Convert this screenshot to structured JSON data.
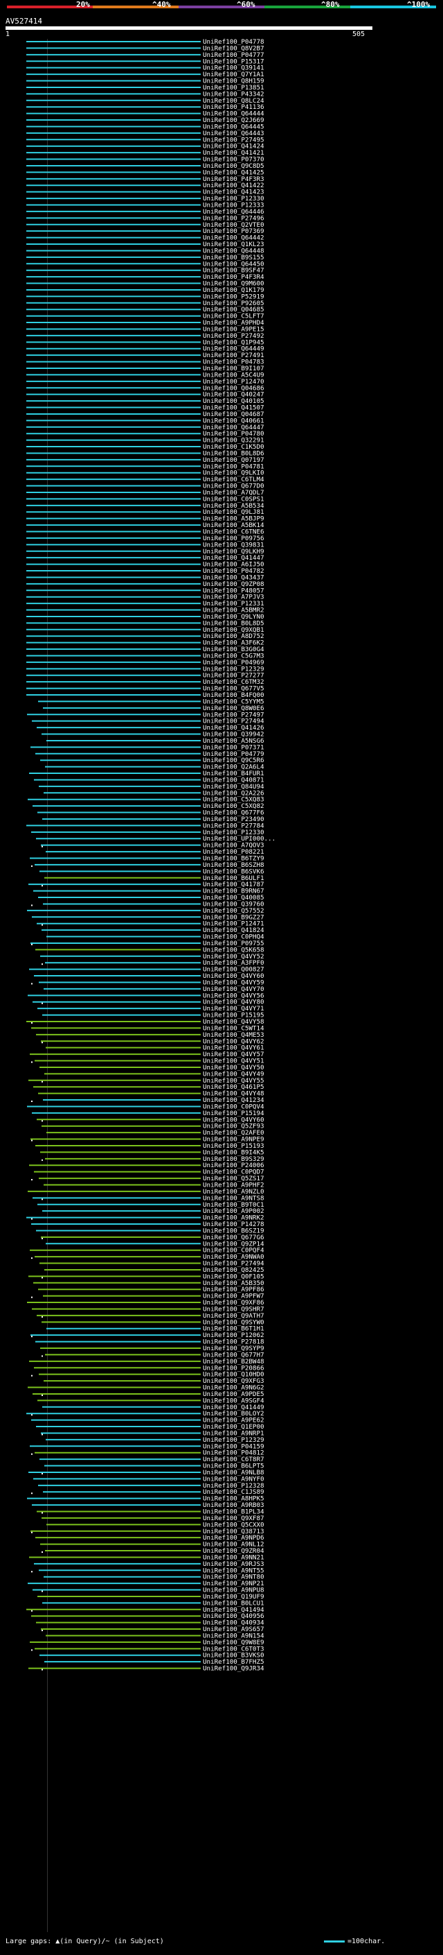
{
  "legend": {
    "labels": [
      "20%",
      "^40%",
      "^60%",
      "^80%",
      "^100%"
    ],
    "colors": [
      "#d8202a",
      "#e07a1c",
      "#7b3fa0",
      "#18a33b",
      "#18c6e0"
    ]
  },
  "query_id": "AV527414",
  "ruler": {
    "start": "1",
    "end": "505"
  },
  "colors": {
    "full": "#2fd0e2",
    "partial": "#7cc21c",
    "marker": "#ffffff",
    "bg": "#000000"
  },
  "hits": [
    "UniRef100_P04778",
    "UniRef100_Q8V2B7",
    "UniRef100_P04777",
    "UniRef100_P15317",
    "UniRef100_Q39141",
    "UniRef100_Q7Y1A1",
    "UniRef100_Q8H159",
    "UniRef100_P13851",
    "UniRef100_P43342",
    "UniRef100_Q8LC24",
    "UniRef100_P41136",
    "UniRef100_Q64444",
    "UniRef100_Q2J669",
    "UniRef100_Q64445",
    "UniRef100_Q64443",
    "UniRef100_P27495",
    "UniRef100_Q41424",
    "UniRef100_Q41421",
    "UniRef100_P07370",
    "UniRef100_Q9C8D5",
    "UniRef100_Q41425",
    "UniRef100_P4F3R3",
    "UniRef100_Q41422",
    "UniRef100_Q41423",
    "UniRef100_P12330",
    "UniRef100_P12333",
    "UniRef100_Q64446",
    "UniRef100_P27496",
    "UniRef100_Q2VTE0",
    "UniRef100_P07369",
    "UniRef100_Q64442",
    "UniRef100_Q1KL23",
    "UniRef100_Q64448",
    "UniRef100_B9S155",
    "UniRef100_Q64450",
    "UniRef100_B9SF47",
    "UniRef100_P4F3R4",
    "UniRef100_Q9M600",
    "UniRef100_Q1K179",
    "UniRef100_P52919",
    "UniRef100_P92605",
    "UniRef100_Q04685",
    "UniRef100_C5LFT7",
    "UniRef100_A9PHD4",
    "UniRef100_A9PE15",
    "UniRef100_P27492",
    "UniRef100_Q1P945",
    "UniRef100_Q64449",
    "UniRef100_P27491",
    "UniRef100_P04783",
    "UniRef100_B9I107",
    "UniRef100_A5C4U9",
    "UniRef100_P12470",
    "UniRef100_Q04686",
    "UniRef100_Q40247",
    "UniRef100_Q40105",
    "UniRef100_Q41507",
    "UniRef100_Q04687",
    "UniRef100_Q40661",
    "UniRef100_Q64447",
    "UniRef100_P04780",
    "UniRef100_Q32291",
    "UniRef100_C1K5D0",
    "UniRef100_B0L8D6",
    "UniRef100_Q07197",
    "UniRef100_P04781",
    "UniRef100_Q9LKI0",
    "UniRef100_C6TLM4",
    "UniRef100_Q677D0",
    "UniRef100_A7QDL7",
    "UniRef100_C0SPS1",
    "UniRef100_A5B534",
    "UniRef100_Q9LJ81",
    "UniRef100_A5BJP9",
    "UniRef100_A5BK14",
    "UniRef100_C6TNE6",
    "UniRef100_P09756",
    "UniRef100_Q39831",
    "UniRef100_Q9LKH9",
    "UniRef100_Q41447",
    "UniRef100_A6IJ50",
    "UniRef100_P04782",
    "UniRef100_Q43437",
    "UniRef100_Q9ZP08",
    "UniRef100_P48057",
    "UniRef100_A7PJV3",
    "UniRef100_P12331",
    "UniRef100_A5BMR2",
    "UniRef100_Q9LYN0",
    "UniRef100_B0L8D5",
    "UniRef100_Q9XQB1",
    "UniRef100_A8D752",
    "UniRef100_A3F6K2",
    "UniRef100_B3G0G4",
    "UniRef100_C5G7M3",
    "UniRef100_P04969",
    "UniRef100_P12329",
    "UniRef100_P27277",
    "UniRef100_C6TM32",
    "UniRef100_Q677V5",
    "UniRef100_B4FQ00",
    "UniRef100_C5YYM5",
    "UniRef100_Q8W0E6",
    "UniRef100_P27497",
    "UniRef100_P27494",
    "UniRef100_Q41426",
    "UniRef100_Q39942",
    "UniRef100_A5NSG6",
    "UniRef100_P07371",
    "UniRef100_P04779",
    "UniRef100_Q9C5R6",
    "UniRef100_Q2A6L4",
    "UniRef100_B4FUR1",
    "UniRef100_Q40871",
    "UniRef100_Q84U94",
    "UniRef100_Q2A226",
    "UniRef100_C5XQ83",
    "UniRef100_C5XQ82",
    "UniRef100_Q677F6",
    "UniRef100_P23490",
    "UniRef100_P27784",
    "UniRef100_P12330",
    "UniRef100_UPI000...",
    "UniRef100_A7QOV3",
    "UniRef100_P08221",
    "UniRef100_B6TZY9",
    "UniRef100_B6SZH8",
    "UniRef100_B6SVK6",
    "UniRef100_B6ULF1",
    "UniRef100_Q41787",
    "UniRef100_B9RN67",
    "UniRef100_Q40085",
    "UniRef100_Q39760",
    "UniRef100_Q57552",
    "UniRef100_B9GZ27",
    "UniRef100_P12471",
    "UniRef100_Q41824",
    "UniRef100_C0PHQ4",
    "UniRef100_P09755",
    "UniRef100_Q5K658",
    "UniRef100_Q4VY52",
    "UniRef100_A3FPF0",
    "UniRef100_Q00827",
    "UniRef100_Q4VY60",
    "UniRef100_Q4VY59",
    "UniRef100_Q4VY70",
    "UniRef100_Q4VY56",
    "UniRef100_Q4VY80",
    "UniRef100_Q4VY71",
    "UniRef100_P15195",
    "UniRef100_Q4VY58",
    "UniRef100_C5WT14",
    "UniRef100_Q4ME53",
    "UniRef100_Q4VY62",
    "UniRef100_Q4VY61",
    "UniRef100_Q4VY57",
    "UniRef100_Q4VY51",
    "UniRef100_Q4VY50",
    "UniRef100_Q4VY49",
    "UniRef100_Q4VY55",
    "UniRef100_Q461P5",
    "UniRef100_Q4VY48",
    "UniRef100_Q41234",
    "UniRef100_C0PQV4",
    "UniRef100_P15194",
    "UniRef100_Q4VY60",
    "UniRef100_Q5ZF93",
    "UniRef100_Q2AFE0",
    "UniRef100_A9NPE9",
    "UniRef100_P15193",
    "UniRef100_B9I4K5",
    "UniRef100_B9S329",
    "UniRef100_P24006",
    "UniRef100_C0PQD7",
    "UniRef100_Q5ZS17",
    "UniRef100_A9PHF2",
    "UniRef100_A9NZL0",
    "UniRef100_A9NTS8",
    "UniRef100_B9T0C1",
    "UniRef100_A9P002",
    "UniRef100_A9NRK2",
    "UniRef100_P14278",
    "UniRef100_B6SZ19",
    "UniRef100_Q677G6",
    "UniRef100_Q9ZP14",
    "UniRef100_C0PQF4",
    "UniRef100_A9NWA0",
    "UniRef100_P27494",
    "UniRef100_Q82425",
    "UniRef100_Q0F105",
    "UniRef100_A5B350",
    "UniRef100_A9PF86",
    "UniRef100_A9PFW7",
    "UniRef100_Q9XF86",
    "UniRef100_Q9SHR7",
    "UniRef100_Q9ATH7",
    "UniRef100_Q9SYW0",
    "UniRef100_B6T1H1",
    "UniRef100_P12062",
    "UniRef100_P27818",
    "UniRef100_Q9SYP9",
    "UniRef100_Q677H7",
    "UniRef100_B2BW48",
    "UniRef100_P20866",
    "UniRef100_Q10HD0",
    "UniRef100_Q9XFG3",
    "UniRef100_A9N6G2",
    "UniRef100_A9PDE5",
    "UniRef100_A9SGF4",
    "UniRef100_Q41449",
    "UniRef100_B0LOY2",
    "UniRef100_A9PE62",
    "UniRef100_Q1EP00",
    "UniRef100_A9NRP1",
    "UniRef100_P12329",
    "UniRef100_P04159",
    "UniRef100_P04812",
    "UniRef100_C6T8R7",
    "UniRef100_B6LPT5",
    "UniRef100_A9NLB8",
    "UniRef100_A9NYF0",
    "UniRef100_P12328",
    "UniRef100_C1JS89",
    "UniRef100_A8HPK5",
    "UniRef100_A9RB03",
    "UniRef100_B1PL34",
    "UniRef100_Q9XF87",
    "UniRef100_Q5CXX0",
    "UniRef100_Q38713",
    "UniRef100_A9NPD6",
    "UniRef100_A9NL12",
    "UniRef100_Q9ZR04",
    "UniRef100_A9NN21",
    "UniRef100_A9RJS3",
    "UniRef100_A9NT55",
    "UniRef100_A9NT80",
    "UniRef100_A9NP21",
    "UniRef100_A9NPU8",
    "UniRef100_Q19UF9",
    "UniRef100_B0LCU1",
    "UniRef100_Q41494",
    "UniRef100_Q40956",
    "UniRef100_Q40934",
    "UniRef100_A9S657",
    "UniRef100_A9N154",
    "UniRef100_Q9W8E9",
    "UniRef100_C6T0T3",
    "UniRef100_B3VKS0",
    "UniRef100_B7FHZ5",
    "UniRef100_Q9JR34"
  ],
  "footer": {
    "left": "Large gaps: ▲(in Query)/~ (in Subject)",
    "right": "=100char."
  }
}
